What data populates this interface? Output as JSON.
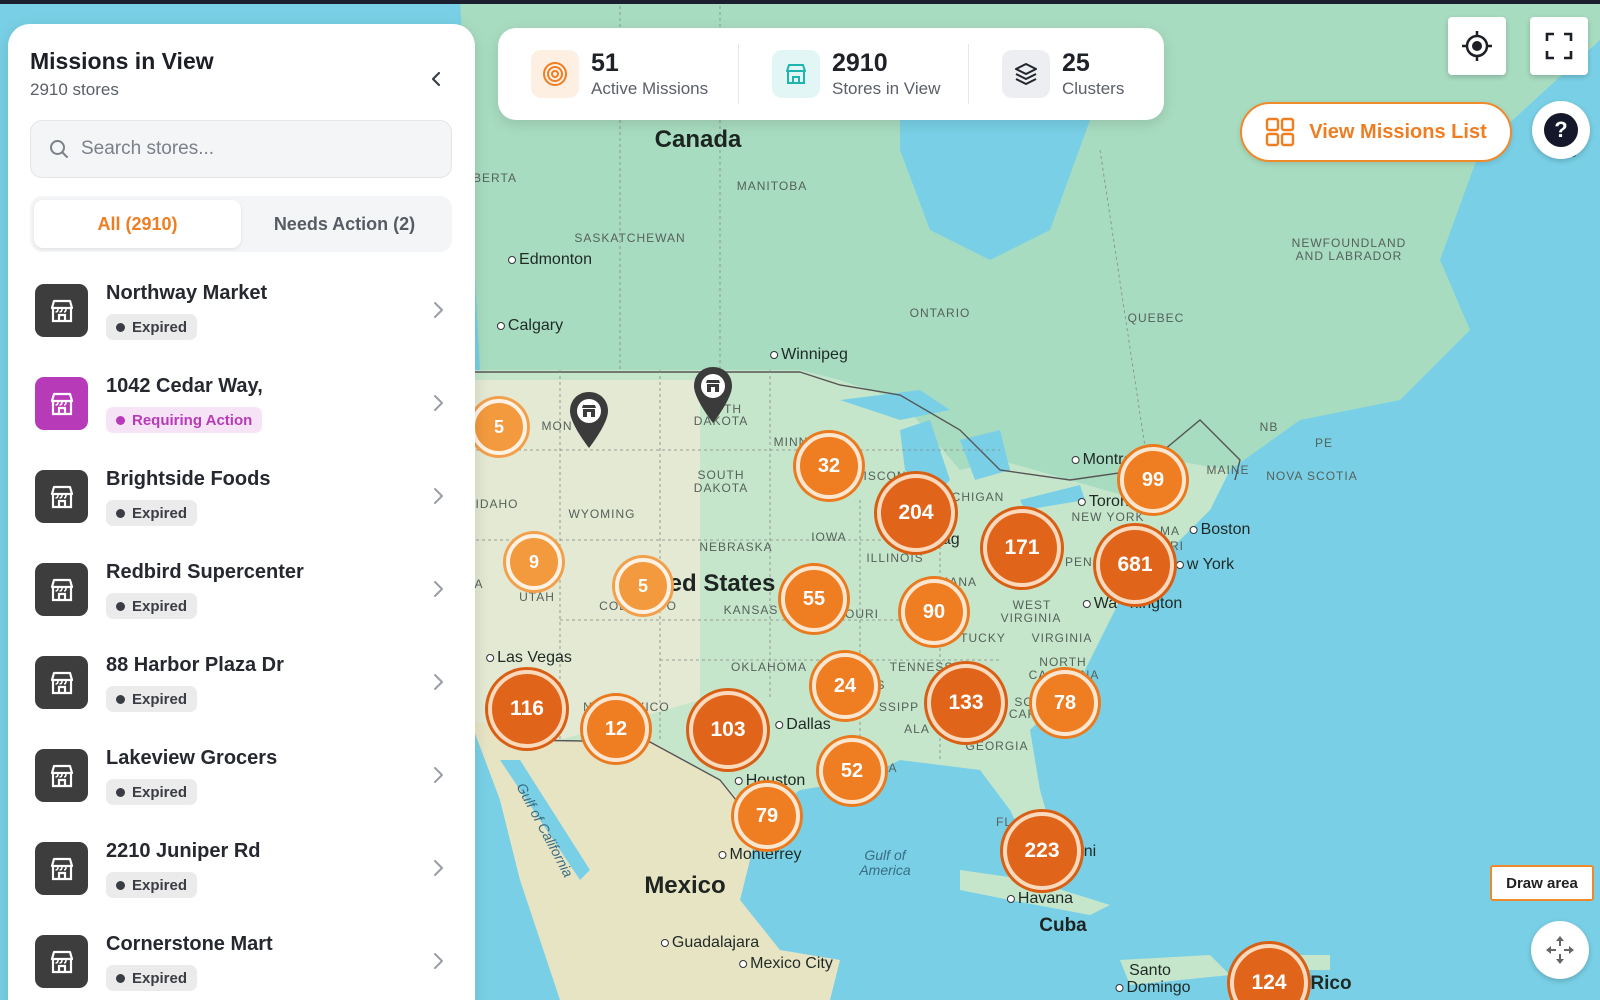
{
  "panel": {
    "title": "Missions in View",
    "subtitle": "2910 stores",
    "search_placeholder": "Search stores...",
    "tabs": [
      {
        "label": "All (2910)",
        "active": true
      },
      {
        "label": "Needs Action (2)",
        "active": false
      }
    ],
    "stores": [
      {
        "name": "Northway Market",
        "status": "Expired",
        "icon_color": "#3d3d3d"
      },
      {
        "name": "1042 Cedar Way,",
        "status": "Requiring Action",
        "icon_color": "#b73ab8"
      },
      {
        "name": "Brightside Foods",
        "status": "Expired",
        "icon_color": "#3d3d3d"
      },
      {
        "name": "Redbird Supercenter",
        "status": "Expired",
        "icon_color": "#3d3d3d"
      },
      {
        "name": "88 Harbor Plaza Dr",
        "status": "Expired",
        "icon_color": "#3d3d3d"
      },
      {
        "name": "Lakeview Grocers",
        "status": "Expired",
        "icon_color": "#3d3d3d"
      },
      {
        "name": "2210 Juniper Rd",
        "status": "Expired",
        "icon_color": "#3d3d3d"
      },
      {
        "name": "Cornerstone Mart",
        "status": "Expired",
        "icon_color": "#3d3d3d"
      }
    ]
  },
  "stats": [
    {
      "value": "51",
      "label": "Active Missions",
      "icon": "target-icon"
    },
    {
      "value": "2910",
      "label": "Stores in View",
      "icon": "store-icon"
    },
    {
      "value": "25",
      "label": "Clusters",
      "icon": "layers-icon"
    }
  ],
  "controls": {
    "view_list_label": "View Missions List",
    "help_label": "?",
    "draw_area_label": "Draw area"
  },
  "map": {
    "countries": [
      "Canada",
      "ted States",
      "Mexico",
      "Cuba"
    ],
    "states": [
      "BERTA",
      "MANITOBA",
      "SASKATCHEWAN",
      "ONTARIO",
      "QUEBEC",
      "NEWFOUNDLAND",
      "AND LABRADOR",
      "NB",
      "PE",
      "MAINE",
      "NOVA SCOTIA",
      "MON",
      "TH",
      "DAKOTA",
      "MINN",
      "SOUTH",
      "DAKOTA",
      "WYOMING",
      "IDAHO",
      "NEBRASKA",
      "IOWA",
      "ISCON",
      "CHIGAN",
      "ILLINOIS",
      "UTAH",
      "COL",
      "DO",
      "KANSAS",
      "OURI",
      "IANA",
      "WEST",
      "VIRGINIA",
      "VIRGINIA",
      "TUCKY",
      "OKLAHOMA",
      "TENNESSE",
      "NORTH",
      "CA",
      "NA",
      "SSIPP",
      "ALA",
      "GEORGIA",
      "SO",
      "CAR",
      "NEW YORK",
      "PENI",
      "MA",
      "RI",
      "A",
      "XICO",
      "FL",
      "N",
      "S",
      "A"
    ],
    "cities": [
      "Edmonton",
      "Calgary",
      "Winnipeg",
      "Toronto",
      "Montre",
      "Boston",
      "w York",
      "Wa",
      "hington",
      "Las Vegas",
      "Dallas",
      "Houston",
      "Monterrey",
      "Guadalajara",
      "Mexico City",
      "Havana",
      "Santo",
      "Domingo",
      "icag",
      "ni",
      "Rico",
      "rado"
    ],
    "water": [
      "Gulf of",
      "America",
      "Gulf of California"
    ],
    "clusters": [
      {
        "count": "5",
        "size": "sm"
      },
      {
        "count": "32",
        "size": "md"
      },
      {
        "count": "204",
        "size": "lg"
      },
      {
        "count": "99",
        "size": "md"
      },
      {
        "count": "171",
        "size": "lg"
      },
      {
        "count": "681",
        "size": "lg"
      },
      {
        "count": "9",
        "size": "sm"
      },
      {
        "count": "5",
        "size": "sm"
      },
      {
        "count": "55",
        "size": "md"
      },
      {
        "count": "90",
        "size": "md"
      },
      {
        "count": "116",
        "size": "lg"
      },
      {
        "count": "12",
        "size": "md"
      },
      {
        "count": "103",
        "size": "lg"
      },
      {
        "count": "24",
        "size": "md"
      },
      {
        "count": "133",
        "size": "lg"
      },
      {
        "count": "78",
        "size": "md"
      },
      {
        "count": "52",
        "size": "md"
      },
      {
        "count": "79",
        "size": "md"
      },
      {
        "count": "223",
        "size": "lg"
      },
      {
        "count": "124",
        "size": "lg"
      }
    ]
  },
  "colors": {
    "accent": "#ef7d22",
    "expired_badge_bg": "#ebebeb",
    "action_badge_bg": "#f7e3f6",
    "action_text": "#b73ab8"
  }
}
